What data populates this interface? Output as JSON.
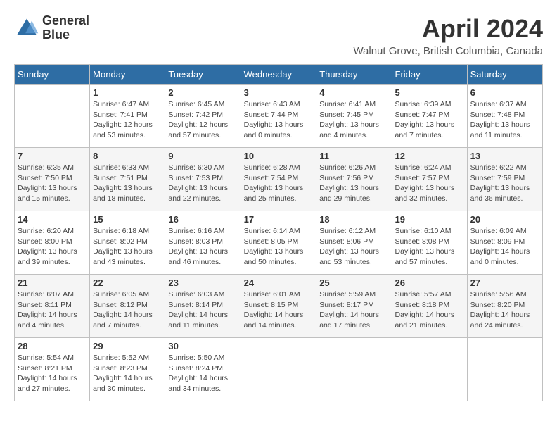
{
  "logo": {
    "line1": "General",
    "line2": "Blue"
  },
  "title": "April 2024",
  "location": "Walnut Grove, British Columbia, Canada",
  "days_of_week": [
    "Sunday",
    "Monday",
    "Tuesday",
    "Wednesday",
    "Thursday",
    "Friday",
    "Saturday"
  ],
  "weeks": [
    [
      {
        "day": "",
        "sunrise": "",
        "sunset": "",
        "daylight": ""
      },
      {
        "day": "1",
        "sunrise": "Sunrise: 6:47 AM",
        "sunset": "Sunset: 7:41 PM",
        "daylight": "Daylight: 12 hours and 53 minutes."
      },
      {
        "day": "2",
        "sunrise": "Sunrise: 6:45 AM",
        "sunset": "Sunset: 7:42 PM",
        "daylight": "Daylight: 12 hours and 57 minutes."
      },
      {
        "day": "3",
        "sunrise": "Sunrise: 6:43 AM",
        "sunset": "Sunset: 7:44 PM",
        "daylight": "Daylight: 13 hours and 0 minutes."
      },
      {
        "day": "4",
        "sunrise": "Sunrise: 6:41 AM",
        "sunset": "Sunset: 7:45 PM",
        "daylight": "Daylight: 13 hours and 4 minutes."
      },
      {
        "day": "5",
        "sunrise": "Sunrise: 6:39 AM",
        "sunset": "Sunset: 7:47 PM",
        "daylight": "Daylight: 13 hours and 7 minutes."
      },
      {
        "day": "6",
        "sunrise": "Sunrise: 6:37 AM",
        "sunset": "Sunset: 7:48 PM",
        "daylight": "Daylight: 13 hours and 11 minutes."
      }
    ],
    [
      {
        "day": "7",
        "sunrise": "Sunrise: 6:35 AM",
        "sunset": "Sunset: 7:50 PM",
        "daylight": "Daylight: 13 hours and 15 minutes."
      },
      {
        "day": "8",
        "sunrise": "Sunrise: 6:33 AM",
        "sunset": "Sunset: 7:51 PM",
        "daylight": "Daylight: 13 hours and 18 minutes."
      },
      {
        "day": "9",
        "sunrise": "Sunrise: 6:30 AM",
        "sunset": "Sunset: 7:53 PM",
        "daylight": "Daylight: 13 hours and 22 minutes."
      },
      {
        "day": "10",
        "sunrise": "Sunrise: 6:28 AM",
        "sunset": "Sunset: 7:54 PM",
        "daylight": "Daylight: 13 hours and 25 minutes."
      },
      {
        "day": "11",
        "sunrise": "Sunrise: 6:26 AM",
        "sunset": "Sunset: 7:56 PM",
        "daylight": "Daylight: 13 hours and 29 minutes."
      },
      {
        "day": "12",
        "sunrise": "Sunrise: 6:24 AM",
        "sunset": "Sunset: 7:57 PM",
        "daylight": "Daylight: 13 hours and 32 minutes."
      },
      {
        "day": "13",
        "sunrise": "Sunrise: 6:22 AM",
        "sunset": "Sunset: 7:59 PM",
        "daylight": "Daylight: 13 hours and 36 minutes."
      }
    ],
    [
      {
        "day": "14",
        "sunrise": "Sunrise: 6:20 AM",
        "sunset": "Sunset: 8:00 PM",
        "daylight": "Daylight: 13 hours and 39 minutes."
      },
      {
        "day": "15",
        "sunrise": "Sunrise: 6:18 AM",
        "sunset": "Sunset: 8:02 PM",
        "daylight": "Daylight: 13 hours and 43 minutes."
      },
      {
        "day": "16",
        "sunrise": "Sunrise: 6:16 AM",
        "sunset": "Sunset: 8:03 PM",
        "daylight": "Daylight: 13 hours and 46 minutes."
      },
      {
        "day": "17",
        "sunrise": "Sunrise: 6:14 AM",
        "sunset": "Sunset: 8:05 PM",
        "daylight": "Daylight: 13 hours and 50 minutes."
      },
      {
        "day": "18",
        "sunrise": "Sunrise: 6:12 AM",
        "sunset": "Sunset: 8:06 PM",
        "daylight": "Daylight: 13 hours and 53 minutes."
      },
      {
        "day": "19",
        "sunrise": "Sunrise: 6:10 AM",
        "sunset": "Sunset: 8:08 PM",
        "daylight": "Daylight: 13 hours and 57 minutes."
      },
      {
        "day": "20",
        "sunrise": "Sunrise: 6:09 AM",
        "sunset": "Sunset: 8:09 PM",
        "daylight": "Daylight: 14 hours and 0 minutes."
      }
    ],
    [
      {
        "day": "21",
        "sunrise": "Sunrise: 6:07 AM",
        "sunset": "Sunset: 8:11 PM",
        "daylight": "Daylight: 14 hours and 4 minutes."
      },
      {
        "day": "22",
        "sunrise": "Sunrise: 6:05 AM",
        "sunset": "Sunset: 8:12 PM",
        "daylight": "Daylight: 14 hours and 7 minutes."
      },
      {
        "day": "23",
        "sunrise": "Sunrise: 6:03 AM",
        "sunset": "Sunset: 8:14 PM",
        "daylight": "Daylight: 14 hours and 11 minutes."
      },
      {
        "day": "24",
        "sunrise": "Sunrise: 6:01 AM",
        "sunset": "Sunset: 8:15 PM",
        "daylight": "Daylight: 14 hours and 14 minutes."
      },
      {
        "day": "25",
        "sunrise": "Sunrise: 5:59 AM",
        "sunset": "Sunset: 8:17 PM",
        "daylight": "Daylight: 14 hours and 17 minutes."
      },
      {
        "day": "26",
        "sunrise": "Sunrise: 5:57 AM",
        "sunset": "Sunset: 8:18 PM",
        "daylight": "Daylight: 14 hours and 21 minutes."
      },
      {
        "day": "27",
        "sunrise": "Sunrise: 5:56 AM",
        "sunset": "Sunset: 8:20 PM",
        "daylight": "Daylight: 14 hours and 24 minutes."
      }
    ],
    [
      {
        "day": "28",
        "sunrise": "Sunrise: 5:54 AM",
        "sunset": "Sunset: 8:21 PM",
        "daylight": "Daylight: 14 hours and 27 minutes."
      },
      {
        "day": "29",
        "sunrise": "Sunrise: 5:52 AM",
        "sunset": "Sunset: 8:23 PM",
        "daylight": "Daylight: 14 hours and 30 minutes."
      },
      {
        "day": "30",
        "sunrise": "Sunrise: 5:50 AM",
        "sunset": "Sunset: 8:24 PM",
        "daylight": "Daylight: 14 hours and 34 minutes."
      },
      {
        "day": "",
        "sunrise": "",
        "sunset": "",
        "daylight": ""
      },
      {
        "day": "",
        "sunrise": "",
        "sunset": "",
        "daylight": ""
      },
      {
        "day": "",
        "sunrise": "",
        "sunset": "",
        "daylight": ""
      },
      {
        "day": "",
        "sunrise": "",
        "sunset": "",
        "daylight": ""
      }
    ]
  ]
}
